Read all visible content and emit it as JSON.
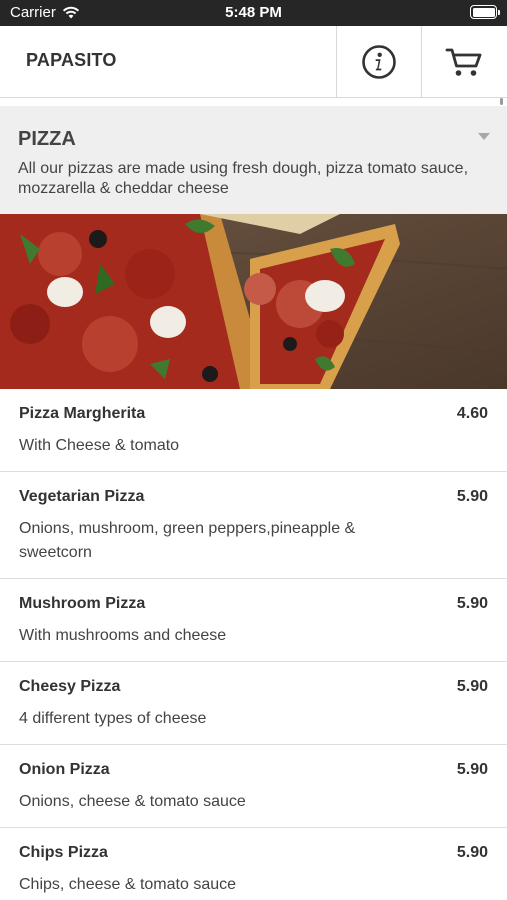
{
  "status_bar": {
    "carrier": "Carrier",
    "time": "5:48 PM"
  },
  "nav": {
    "title": "PAPASITO",
    "info_icon": "info-icon",
    "cart_icon": "cart-icon"
  },
  "category": {
    "title": "PIZZA",
    "description": "All our pizzas are made using fresh dough, pizza tomato sauce, mozzarella & cheddar cheese"
  },
  "items": [
    {
      "name": "Pizza Margherita",
      "price": "4.60",
      "description": "With Cheese & tomato"
    },
    {
      "name": "Vegetarian Pizza",
      "price": "5.90",
      "description": "Onions, mushroom, green peppers,pineapple & sweetcorn"
    },
    {
      "name": "Mushroom Pizza",
      "price": "5.90",
      "description": "With mushrooms and cheese"
    },
    {
      "name": "Cheesy Pizza",
      "price": "5.90",
      "description": "4 different types of cheese"
    },
    {
      "name": "Onion Pizza",
      "price": "5.90",
      "description": "Onions, cheese & tomato sauce"
    },
    {
      "name": "Chips Pizza",
      "price": "5.90",
      "description": "Chips, cheese & tomato sauce"
    }
  ],
  "colors": {
    "status_bar_bg": "#262626",
    "header_bg": "#efefef",
    "divider": "#dedede",
    "text": "#333333"
  }
}
